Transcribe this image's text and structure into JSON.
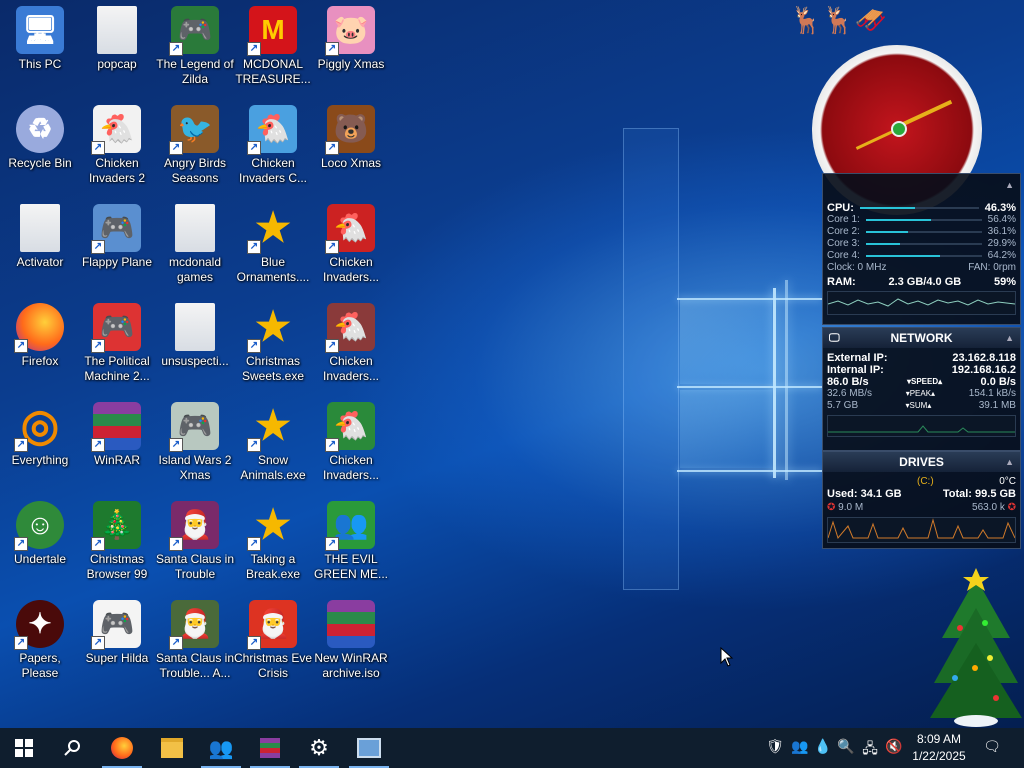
{
  "desktop": {
    "icons": [
      {
        "label": "This PC",
        "icon": "computer-icon",
        "shortcut": false,
        "color": "#3a7bd5"
      },
      {
        "label": "Recycle Bin",
        "icon": "recycle-bin-icon",
        "shortcut": false,
        "color": "#9ad"
      },
      {
        "label": "Activator",
        "icon": "folder-icon",
        "shortcut": false,
        "color": "#e8e8e8"
      },
      {
        "label": "Firefox",
        "icon": "firefox-icon",
        "shortcut": true,
        "color": "#ff7b1a"
      },
      {
        "label": "Everything",
        "icon": "search-icon",
        "shortcut": true,
        "color": "#f08a00"
      },
      {
        "label": "Undertale",
        "icon": "undertale-icon",
        "shortcut": true,
        "color": "#2f8a3a"
      },
      {
        "label": "Papers, Please",
        "icon": "papers-please-icon",
        "shortcut": true,
        "color": "#4a0a0a"
      },
      {
        "label": "popcap",
        "icon": "folder-icon",
        "shortcut": false,
        "color": "#e0e6ee"
      },
      {
        "label": "Chicken Invaders 2",
        "icon": "chicken-icon",
        "shortcut": true,
        "color": "#f2f2f2"
      },
      {
        "label": "Flappy Plane",
        "icon": "game-icon",
        "shortcut": true,
        "color": "#5a8fd0"
      },
      {
        "label": "The Political Machine 2...",
        "icon": "game-icon",
        "shortcut": true,
        "color": "#d33"
      },
      {
        "label": "WinRAR",
        "icon": "winrar-icon",
        "shortcut": true,
        "color": "#8a3da0"
      },
      {
        "label": "Christmas Browser 99",
        "icon": "tree-icon",
        "shortcut": true,
        "color": "#1e7a2e"
      },
      {
        "label": "Super Hilda",
        "icon": "game-icon",
        "shortcut": true,
        "color": "#f4f4f4"
      },
      {
        "label": "The Legend of Zilda",
        "icon": "game-icon",
        "shortcut": true,
        "color": "#2a7a3a"
      },
      {
        "label": "Angry Birds Seasons",
        "icon": "angry-birds-icon",
        "shortcut": true,
        "color": "#8a5a2a"
      },
      {
        "label": "mcdonald games",
        "icon": "folder-icon",
        "shortcut": false,
        "color": "#e8e8e8"
      },
      {
        "label": "unsuspecti...",
        "icon": "folder-icon",
        "shortcut": false,
        "color": "#e8e8e8"
      },
      {
        "label": "Island Wars 2 Xmas",
        "icon": "game-icon",
        "shortcut": true,
        "color": "#b8c8c0"
      },
      {
        "label": "Santa Claus in Trouble",
        "icon": "santa-icon",
        "shortcut": true,
        "color": "#7a2a6a"
      },
      {
        "label": "Santa Claus in Trouble... A...",
        "icon": "santa-icon",
        "shortcut": true,
        "color": "#4a6a3a"
      },
      {
        "label": "MCDONAL TREASURE...",
        "icon": "mcdonalds-icon",
        "shortcut": true,
        "color": "#d4141a"
      },
      {
        "label": "Chicken Invaders C...",
        "icon": "chicken-icon",
        "shortcut": true,
        "color": "#4aa0e0"
      },
      {
        "label": "Blue Ornaments....",
        "icon": "star-icon",
        "shortcut": true,
        "color": "#f6b800"
      },
      {
        "label": "Christmas Sweets.exe",
        "icon": "star-icon",
        "shortcut": true,
        "color": "#f6b800"
      },
      {
        "label": "Snow Animals.exe",
        "icon": "star-icon",
        "shortcut": true,
        "color": "#f6b800"
      },
      {
        "label": "Taking a Break.exe",
        "icon": "star-icon",
        "shortcut": true,
        "color": "#f6b800"
      },
      {
        "label": "Christmas Eve Crisis",
        "icon": "santa-icon",
        "shortcut": true,
        "color": "#d32"
      },
      {
        "label": "Piggly Xmas",
        "icon": "pig-icon",
        "shortcut": true,
        "color": "#e890c0"
      },
      {
        "label": "Loco Xmas",
        "icon": "bear-icon",
        "shortcut": true,
        "color": "#8a4a1a"
      },
      {
        "label": "Chicken Invaders...",
        "icon": "chicken-icon",
        "shortcut": true,
        "color": "#c22"
      },
      {
        "label": "Chicken Invaders...",
        "icon": "chicken-icon",
        "shortcut": true,
        "color": "#8a3a3a"
      },
      {
        "label": "Chicken Invaders...",
        "icon": "chicken-icon",
        "shortcut": true,
        "color": "#2a8a3a"
      },
      {
        "label": "THE EVIL GREEN ME...",
        "icon": "messenger-icon",
        "shortcut": true,
        "color": "#2a9a3a"
      },
      {
        "label": "New WinRAR archive.iso",
        "icon": "winrar-icon",
        "shortcut": false,
        "color": "#8a3da0"
      }
    ]
  },
  "cpu_panel": {
    "cpu": {
      "label": "CPU:",
      "value": "46.3%",
      "fill": 0.463
    },
    "cores": [
      {
        "label": "Core 1:",
        "value": "56.4%",
        "fill": 0.564
      },
      {
        "label": "Core 2:",
        "value": "36.1%",
        "fill": 0.361
      },
      {
        "label": "Core 3:",
        "value": "29.9%",
        "fill": 0.299
      },
      {
        "label": "Core 4:",
        "value": "64.2%",
        "fill": 0.642
      }
    ],
    "clock": "Clock: 0 MHz",
    "fan": "FAN: 0rpm",
    "ram": {
      "label": "RAM:",
      "value": "2.3 GB/4.0 GB",
      "percent": "59%"
    }
  },
  "network_panel": {
    "title": "NETWORK",
    "external_ip": {
      "label": "External IP:",
      "value": "23.162.8.118"
    },
    "internal_ip": {
      "label": "Internal IP:",
      "value": "192.168.16.2"
    },
    "speed": {
      "left": "86.0 B/s",
      "label": "SPEED",
      "right": "0.0 B/s"
    },
    "peak": {
      "left": "32.6 MB/s",
      "label": "PEAK",
      "right": "154.1 kB/s"
    },
    "sum": {
      "left": "5.7 GB",
      "label": "SUM",
      "right": "39.1 MB"
    }
  },
  "drives_panel": {
    "title": "DRIVES",
    "drive": "(C:)",
    "temp": "0°C",
    "used": "Used: 34.1 GB",
    "total": "Total: 99.5 GB",
    "read": "9.0 M",
    "write": "563.0 k"
  },
  "taskbar": {
    "time": "8:09 AM",
    "date": "1/22/2025",
    "accent": "#7ab4f0"
  }
}
